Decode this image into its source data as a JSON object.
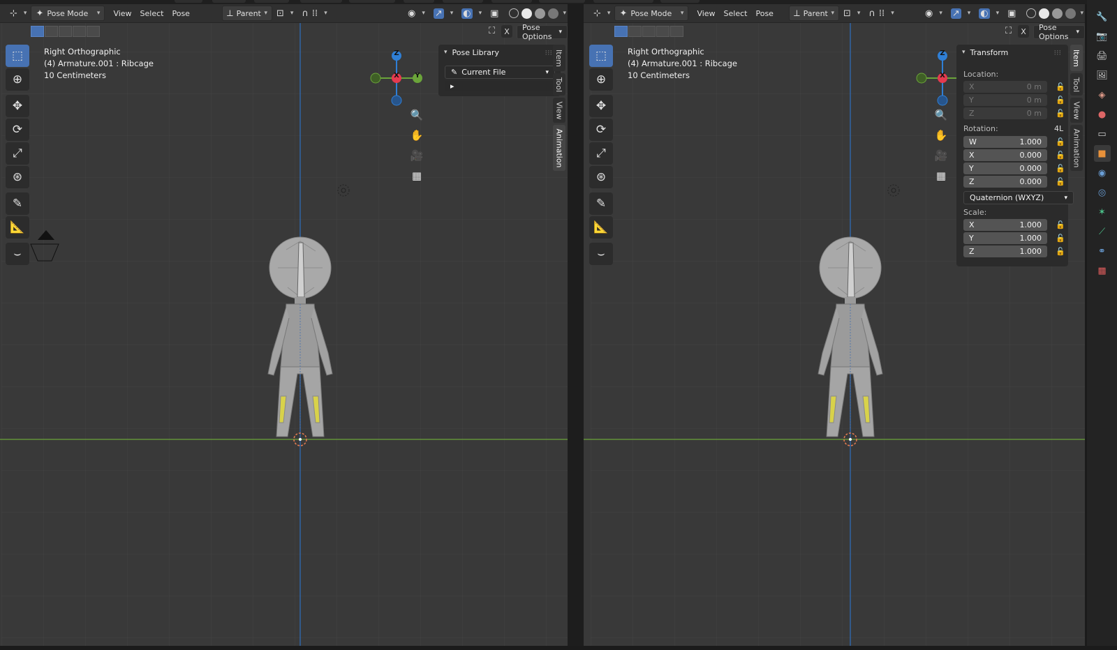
{
  "left": {
    "header": {
      "mode": "Pose Mode",
      "menus": [
        "View",
        "Select",
        "Pose"
      ],
      "pivot": "Parent"
    },
    "pose_options": "Pose Options",
    "close_x": "X",
    "info": [
      "Right Orthographic",
      "(4) Armature.001 : Ribcage",
      "10 Centimeters"
    ],
    "gizmo": {
      "z": "Z",
      "x": "X",
      "y": "Y"
    },
    "panel": {
      "title": "Pose Library",
      "source": "Current File",
      "expand": "▸"
    },
    "tabs": [
      "Item",
      "Tool",
      "View",
      "Animation"
    ],
    "active_tab": "Animation"
  },
  "right": {
    "header": {
      "mode": "Pose Mode",
      "menus": [
        "View",
        "Select",
        "Pose"
      ],
      "pivot": "Parent"
    },
    "pose_options": "Pose Options",
    "close_x": "X",
    "info": [
      "Right Orthographic",
      "(4) Armature.001 : Ribcage",
      "10 Centimeters"
    ],
    "gizmo": {
      "z": "Z",
      "x": "X",
      "y": "Y"
    },
    "transform": {
      "title": "Transform",
      "location_label": "Location:",
      "location": [
        {
          "axis": "X",
          "value": "0 m"
        },
        {
          "axis": "Y",
          "value": "0 m"
        },
        {
          "axis": "Z",
          "value": "0 m"
        }
      ],
      "rotation_label": "Rotation:",
      "rotation_mode_short": "4L",
      "rotation": [
        {
          "axis": "W",
          "value": "1.000"
        },
        {
          "axis": "X",
          "value": "0.000"
        },
        {
          "axis": "Y",
          "value": "0.000"
        },
        {
          "axis": "Z",
          "value": "0.000"
        }
      ],
      "rotation_mode": "Quaternion (WXYZ)",
      "scale_label": "Scale:",
      "scale": [
        {
          "axis": "X",
          "value": "1.000"
        },
        {
          "axis": "Y",
          "value": "1.000"
        },
        {
          "axis": "Z",
          "value": "1.000"
        }
      ]
    },
    "tabs": [
      "Item",
      "Tool",
      "View",
      "Animation"
    ],
    "active_tab": "Item"
  },
  "colors": {
    "x_axis": "#e53a4f",
    "y_axis": "#6ba43a",
    "z_axis": "#2f7fd6",
    "accent": "#4772b3",
    "bone_highlight": "#d8d24a"
  }
}
